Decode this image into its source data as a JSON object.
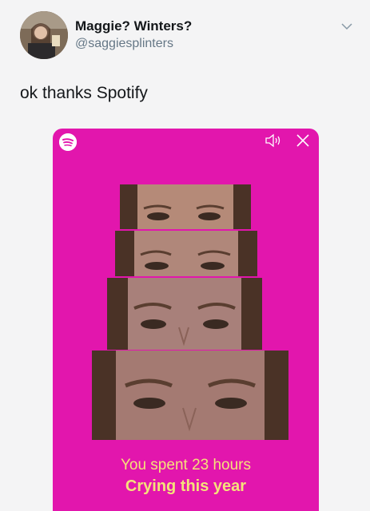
{
  "tweet": {
    "display_name": "Maggie? Winters?",
    "handle": "@saggiesplinters",
    "text": "ok thanks Spotify",
    "menu_icon": "chevron-down-icon"
  },
  "story": {
    "background_color": "#e216ad",
    "caption_line_1": "You spent 23 hours",
    "caption_line_2": "Crying this year",
    "caption_color": "#f5e27a",
    "icons": [
      "spotify-logo-icon",
      "speaker-icon",
      "close-icon"
    ]
  }
}
